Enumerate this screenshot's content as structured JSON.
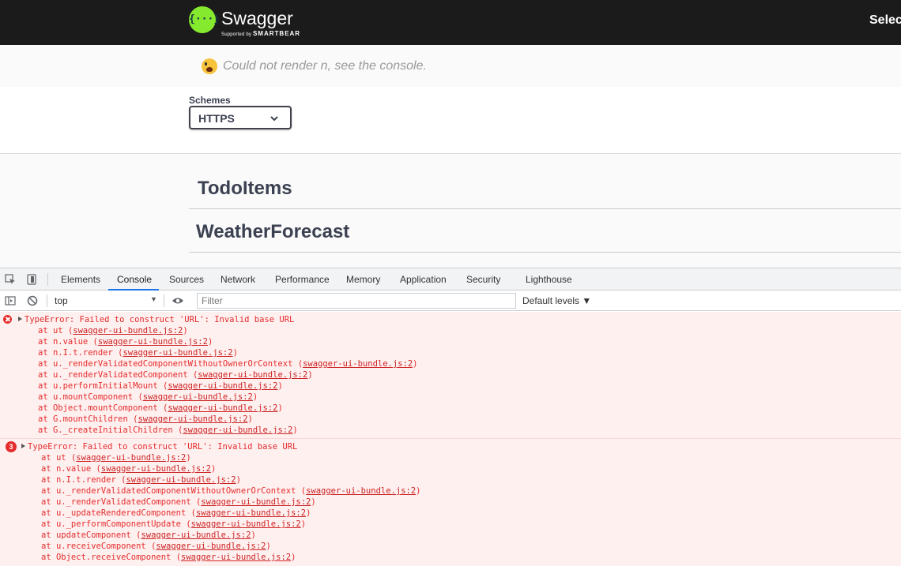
{
  "header": {
    "brand": "Swagger",
    "brand_sub_prefix": "Supported by ",
    "brand_sub": "SMARTBEAR",
    "logo_glyph": "{···}",
    "right_text": "Selec"
  },
  "render_error": {
    "icon": "scream-emoji-icon",
    "message": "Could not render n, see the console."
  },
  "schemes": {
    "label": "Schemes",
    "selected": "HTTPS"
  },
  "tags": [
    {
      "label": "TodoItems"
    },
    {
      "label": "WeatherForecast"
    }
  ],
  "devtools": {
    "tabs": [
      {
        "label": "Elements"
      },
      {
        "label": "Console",
        "active": true
      },
      {
        "label": "Sources"
      },
      {
        "label": "Network"
      },
      {
        "label": "Performance"
      },
      {
        "label": "Memory"
      },
      {
        "label": "Application"
      },
      {
        "label": "Security"
      },
      {
        "label": "Lighthouse"
      }
    ],
    "toolbar": {
      "context": "top",
      "filter_placeholder": "Filter",
      "levels": "Default levels ▼"
    },
    "messages": [
      {
        "badge": "",
        "header": "TypeError: Failed to construct 'URL': Invalid base URL",
        "stack": [
          {
            "fn": "at ut ",
            "src": "swagger-ui-bundle.js:2"
          },
          {
            "fn": "at n.value ",
            "src": "swagger-ui-bundle.js:2"
          },
          {
            "fn": "at n.I.t.render ",
            "src": "swagger-ui-bundle.js:2"
          },
          {
            "fn": "at u._renderValidatedComponentWithoutOwnerOrContext ",
            "src": "swagger-ui-bundle.js:2"
          },
          {
            "fn": "at u._renderValidatedComponent ",
            "src": "swagger-ui-bundle.js:2"
          },
          {
            "fn": "at u.performInitialMount ",
            "src": "swagger-ui-bundle.js:2"
          },
          {
            "fn": "at u.mountComponent ",
            "src": "swagger-ui-bundle.js:2"
          },
          {
            "fn": "at Object.mountComponent ",
            "src": "swagger-ui-bundle.js:2"
          },
          {
            "fn": "at G.mountChildren ",
            "src": "swagger-ui-bundle.js:2"
          },
          {
            "fn": "at G._createInitialChildren ",
            "src": "swagger-ui-bundle.js:2"
          }
        ]
      },
      {
        "badge": "3",
        "header": "TypeError: Failed to construct 'URL': Invalid base URL",
        "stack": [
          {
            "fn": "at ut ",
            "src": "swagger-ui-bundle.js:2"
          },
          {
            "fn": "at n.value ",
            "src": "swagger-ui-bundle.js:2"
          },
          {
            "fn": "at n.I.t.render ",
            "src": "swagger-ui-bundle.js:2"
          },
          {
            "fn": "at u._renderValidatedComponentWithoutOwnerOrContext ",
            "src": "swagger-ui-bundle.js:2"
          },
          {
            "fn": "at u._renderValidatedComponent ",
            "src": "swagger-ui-bundle.js:2"
          },
          {
            "fn": "at u._updateRenderedComponent ",
            "src": "swagger-ui-bundle.js:2"
          },
          {
            "fn": "at u._performComponentUpdate ",
            "src": "swagger-ui-bundle.js:2"
          },
          {
            "fn": "at updateComponent ",
            "src": "swagger-ui-bundle.js:2"
          },
          {
            "fn": "at u.receiveComponent ",
            "src": "swagger-ui-bundle.js:2"
          },
          {
            "fn": "at Object.receiveComponent ",
            "src": "swagger-ui-bundle.js:2"
          }
        ]
      }
    ]
  },
  "colors": {
    "topbar": "#1b1b1b",
    "logo": "#85ea2d",
    "error_text": "#e42b2b",
    "console_error_bg": "#fff0f0"
  }
}
